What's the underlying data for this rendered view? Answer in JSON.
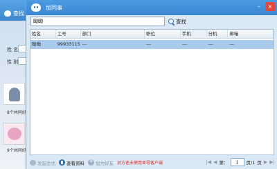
{
  "background_window": {
    "title": "查找",
    "name_label": "姓  名：",
    "gender_label": "性  别：",
    "card1_text": "8个共同好",
    "card2_text": "9个共同好"
  },
  "dialog": {
    "title": "加同事",
    "controls": {
      "minimize": "–",
      "close": "×"
    }
  },
  "search": {
    "value": "呦呦",
    "button_label": "查找"
  },
  "table": {
    "columns": [
      "姓名",
      "工号",
      "部门",
      "职位",
      "手机",
      "分机",
      "邮箱"
    ],
    "rows": [
      [
        "呦呦",
        "99933115",
        "---",
        "---",
        "---",
        "---",
        "---"
      ]
    ]
  },
  "bottombar": {
    "chat_label": "发起会话",
    "view_profile_label": "查看资料",
    "add_friend_label": "加为好友",
    "notice": "对方还未使用亚导客户端",
    "pager": {
      "first": "|◀",
      "prev": "◀",
      "page_prefix": "第：",
      "page_value": "1",
      "page_suffix": "页/1",
      "page_unit": "页",
      "next": "▶",
      "last": "▶|"
    }
  },
  "colors": {
    "titlebar": "#3a86d2",
    "selected_row": "#a9ccee",
    "notice": "#d3261c"
  }
}
